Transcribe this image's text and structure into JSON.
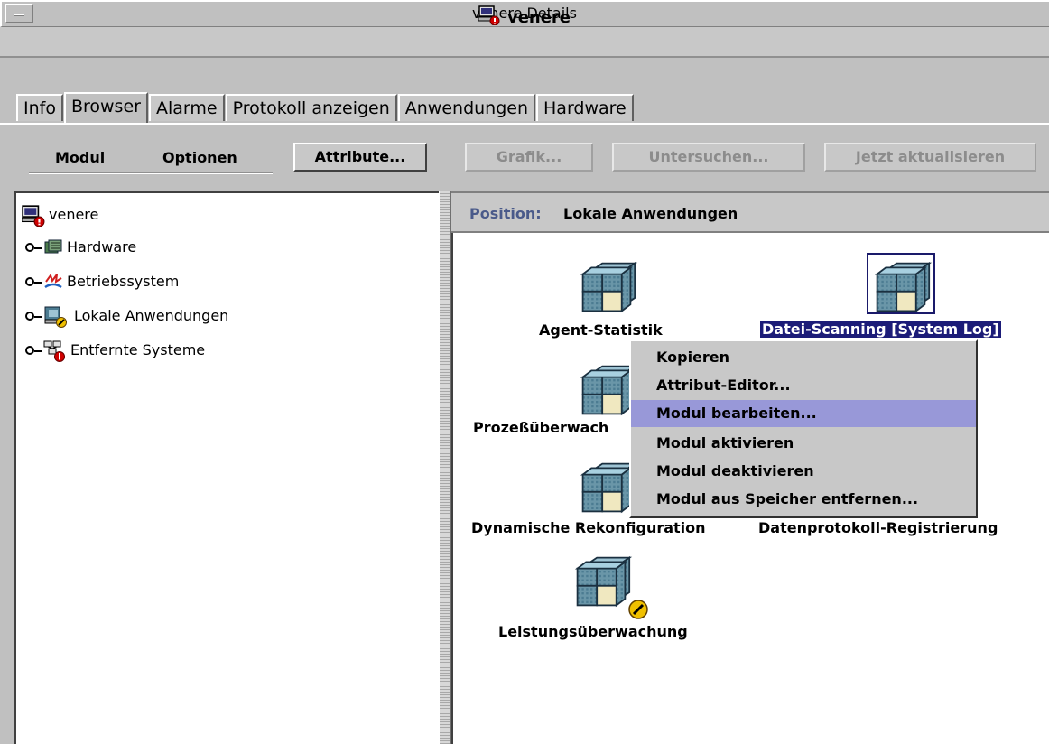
{
  "window": {
    "title": "venere Details"
  },
  "host": {
    "name": "venere"
  },
  "tabs": [
    {
      "label": "Info"
    },
    {
      "label": "Browser",
      "active": true
    },
    {
      "label": "Alarme"
    },
    {
      "label": "Protokoll anzeigen"
    },
    {
      "label": "Anwendungen"
    },
    {
      "label": "Hardware"
    }
  ],
  "toolbar": {
    "menu_modul": "Modul",
    "menu_optionen": "Optionen",
    "attribute_button": "Attribute...",
    "grafik_button": "Grafik...",
    "untersuchen_button": "Untersuchen...",
    "aktualisieren_button": "Jetzt aktualisieren"
  },
  "tree": {
    "root": "venere",
    "items": [
      {
        "label": "Hardware",
        "icon": "hardware-icon"
      },
      {
        "label": "Betriebssystem",
        "icon": "operating-system-icon"
      },
      {
        "label": "Lokale Anwendungen",
        "icon": "local-applications-icon"
      },
      {
        "label": "Entfernte Systeme",
        "icon": "remote-systems-icon"
      }
    ]
  },
  "position": {
    "label": "Position:",
    "value": "Lokale Anwendungen"
  },
  "modules": [
    {
      "label": "Agent-Statistik"
    },
    {
      "label": "Datei-Scanning [System Log]",
      "selected": true
    },
    {
      "label": "Prozeßüberwach"
    },
    {
      "label": "Dynamische Rekonfiguration"
    },
    {
      "label": "Datenprotokoll-Registrierung"
    },
    {
      "label": "Leistungsüberwachung"
    }
  ],
  "context_menu": {
    "items": [
      {
        "label": "Kopieren"
      },
      {
        "label": "Attribut-Editor..."
      },
      {
        "label": "Modul bearbeiten...",
        "highlighted": true
      },
      {
        "label": "Modul aktivieren"
      },
      {
        "label": "Modul deaktivieren"
      },
      {
        "label": "Modul aus Speicher entfernen..."
      }
    ]
  },
  "colors": {
    "selection": "#1c1c78",
    "menu_highlight": "#9898d8",
    "background": "#c0c0c0"
  }
}
